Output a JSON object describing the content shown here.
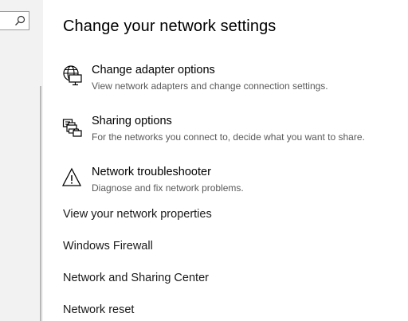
{
  "search": {
    "icon": "search-icon"
  },
  "header": {
    "title": "Change your network settings"
  },
  "settings": [
    {
      "icon": "globe-monitor-icon",
      "label": "Change adapter options",
      "description": "View network adapters and change connection settings."
    },
    {
      "icon": "sharing-printer-icon",
      "label": "Sharing options",
      "description": "For the networks you connect to, decide what you want to share."
    },
    {
      "icon": "warning-icon",
      "label": "Network troubleshooter",
      "description": "Diagnose and fix network problems."
    }
  ],
  "links": [
    "View your network properties",
    "Windows Firewall",
    "Network and Sharing Center",
    "Network reset"
  ],
  "colors": {
    "left_pane": "#f2f2f2",
    "description_text": "#595959"
  }
}
